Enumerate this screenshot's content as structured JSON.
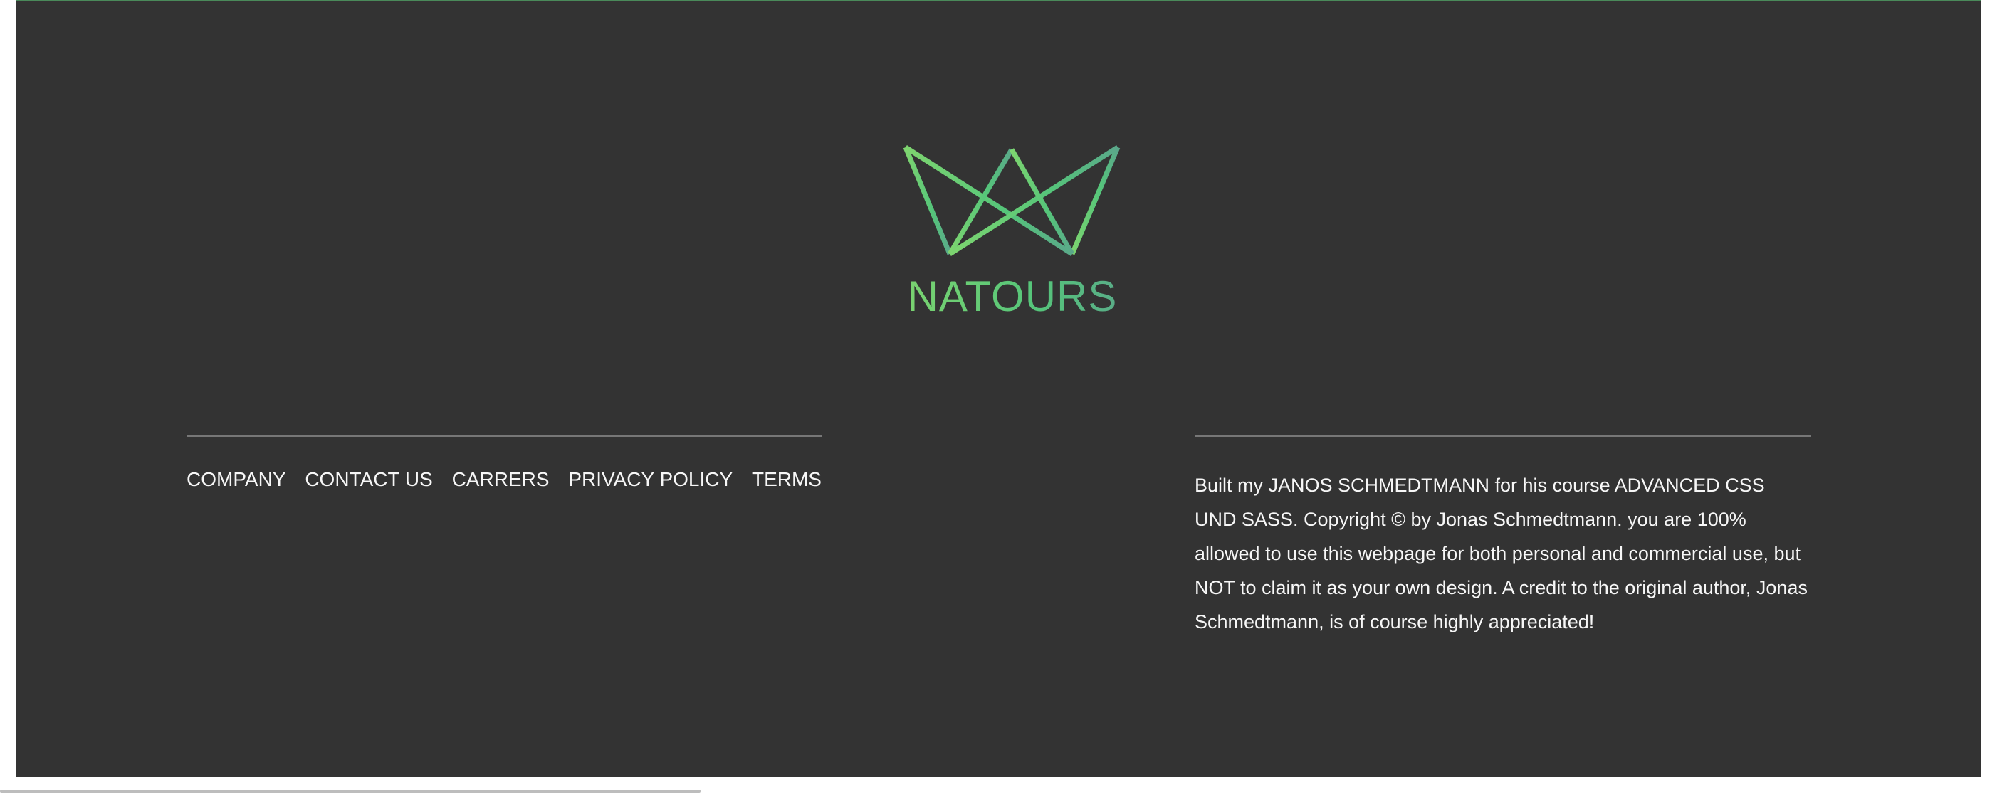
{
  "footer": {
    "logo": {
      "icon": "crown-icon",
      "text": "NATOURS",
      "colors": [
        "#7ed56f",
        "#55c57a",
        "#5aa88a"
      ]
    },
    "nav": {
      "items": [
        {
          "label": "COMPANY"
        },
        {
          "label": "CONTACT US"
        },
        {
          "label": "CARRERS"
        },
        {
          "label": "PRIVACY POLICY"
        },
        {
          "label": "TERMS"
        }
      ]
    },
    "copyright": {
      "text": "Built my JANOS SCHMEDTMANN for his course ADVANCED CSS UND SASS. Copyright © by Jonas Schmedtmann. you are 100% allowed to use this webpage for both personal and commercial use, but NOT to claim it as your own design. A credit to the original author, Jonas Schmedtmann, is of course highly appreciated!"
    },
    "background_color": "#333333",
    "text_color": "#f7f7f7"
  }
}
